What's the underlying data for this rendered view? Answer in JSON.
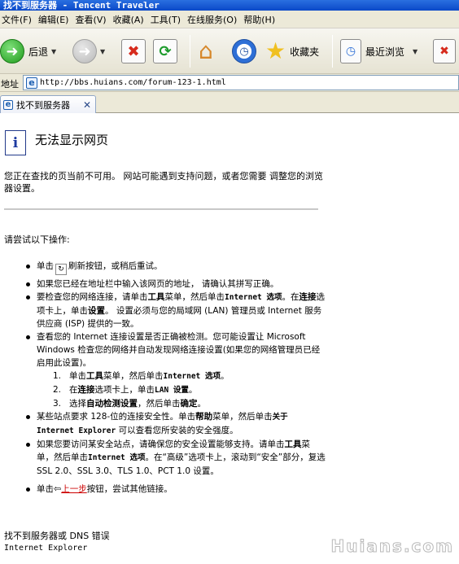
{
  "window": {
    "title": "找不到服务器 - Tencent Traveler"
  },
  "menu": [
    "文件(F)",
    "编辑(E)",
    "查看(V)",
    "收藏(A)",
    "工具(T)",
    "在线服务(O)",
    "帮助(H)"
  ],
  "toolbar": {
    "back_label": "后退",
    "favorites_label": "收藏夹",
    "recent_label": "最近浏览"
  },
  "address": {
    "label": "地址",
    "url": "http://bbs.huians.com/forum-123-1.html"
  },
  "tab": {
    "label": "找不到服务器"
  },
  "page": {
    "heading": "无法显示网页",
    "intro": "您正在查找的页当前不可用。 网站可能遇到支持问题，或者您需要 调整您的浏览器设置。",
    "try_label": "请尝试以下操作:",
    "b1_pre": "单击",
    "b1_post": "刷新按钮，或稍后重试。",
    "b2": "如果您已经在地址栏中输入该网页的地址， 请确认其拼写正确。",
    "b3_a": "要检查您的网络连接，请单击",
    "b3_b": "工具",
    "b3_c": "菜单，然后单击",
    "b3_d": "Internet 选项",
    "b3_e": "。在",
    "b3_f": "连接",
    "b3_g": "选项卡上，单击",
    "b3_h": "设置",
    "b3_i": "。 设置必须与您的局域网 (LAN) 管理员或 Internet 服务供应商 (ISP) 提供的一致。",
    "b4": "查看您的 Internet 连接设置是否正确被检测。您可能设置让 Microsoft Windows 检查您的网络并自动发现网络连接设置(如果您的网络管理员已经启用此设置)。",
    "s1_num": "1.",
    "s1_a": "单击",
    "s1_b": "工具",
    "s1_c": "菜单，然后单击",
    "s1_d": "Internet 选项",
    "s1_e": "。",
    "s2_num": "2.",
    "s2_a": "在",
    "s2_b": "连接",
    "s2_c": "选项卡上，单击",
    "s2_d": "LAN 设置",
    "s2_e": "。",
    "s3_num": "3.",
    "s3_a": "选择",
    "s3_b": "自动检测设置",
    "s3_c": "，然后单击",
    "s3_d": "确定",
    "s3_e": "。",
    "b5_a": "某些站点要求 128-位的连接安全性。单击",
    "b5_b": "帮助",
    "b5_c": "菜单，然后单击",
    "b5_d": "关于 Internet Explorer",
    "b5_e": " 可以查看您所安装的安全强度。",
    "b6_a": "如果您要访问某安全站点，请确保您的安全设置能够支持。请单击",
    "b6_b": "工具",
    "b6_c": "菜单，然后单击",
    "b6_d": "Internet 选项",
    "b6_e": "。在“高级”选项卡上，滚动到“安全”部分，复选 SSL 2.0、SSL 3.0、TLS 1.0、PCT 1.0 设置。",
    "b7_pre": "单击",
    "b7_link": "上一步",
    "b7_post": "按钮，尝试其他链接。",
    "footer_error": "找不到服务器或 DNS 错误",
    "footer_app": "Internet Explorer",
    "watermark": "Huians.com"
  }
}
